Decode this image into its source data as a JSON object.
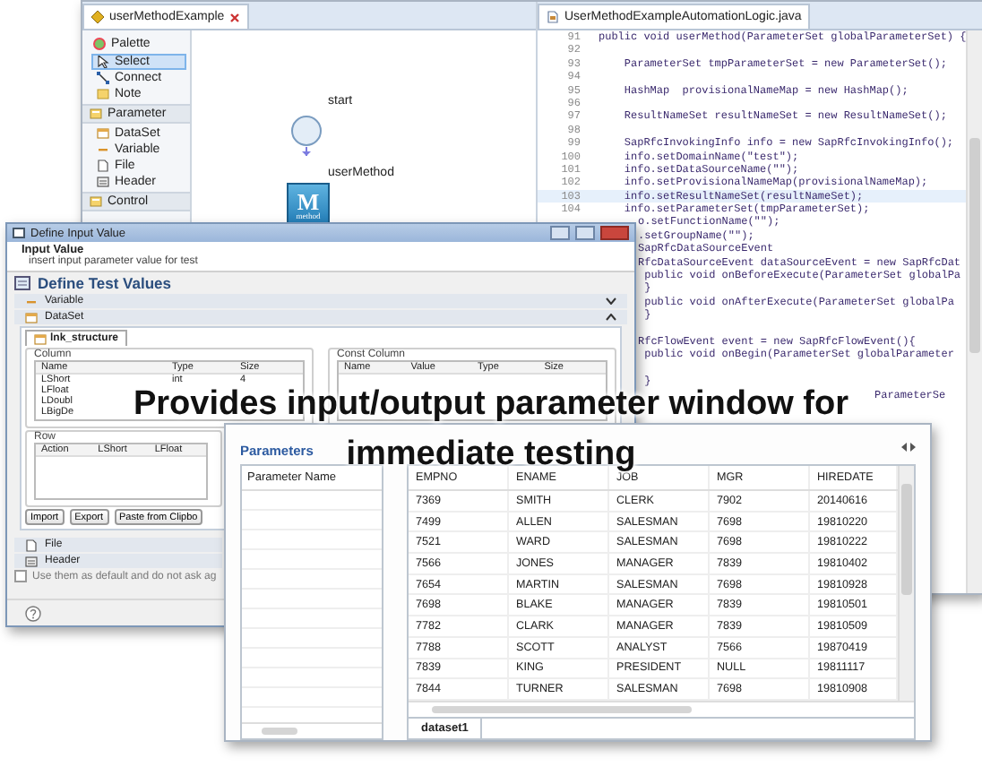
{
  "editor": {
    "diagram_tab": "userMethodExample",
    "code_tab": "UserMethodExampleAutomationLogic.java",
    "palette": {
      "title": "Palette",
      "items": [
        {
          "kind": "select",
          "label": "Select",
          "selected": true
        },
        {
          "kind": "connect",
          "label": "Connect",
          "selected": false
        },
        {
          "kind": "note",
          "label": "Note",
          "selected": false
        },
        {
          "kind": "drawer",
          "label": "Parameter"
        },
        {
          "kind": "dataset",
          "label": "DataSet"
        },
        {
          "kind": "variable",
          "label": "Variable"
        },
        {
          "kind": "file",
          "label": "File"
        },
        {
          "kind": "header",
          "label": "Header"
        },
        {
          "kind": "drawer",
          "label": "Control"
        }
      ]
    },
    "diagram": {
      "start_label": "start",
      "method_label": "userMethod",
      "method_icon_letter": "M",
      "method_icon_caption": "method"
    },
    "code": {
      "lines": [
        {
          "kind": "numbered",
          "number": "91",
          "text": "public void userMethod(ParameterSet globalParameterSet) {",
          "highlighted": false
        },
        {
          "kind": "numbered",
          "number": "92",
          "highlighted": false
        },
        {
          "kind": "numbered",
          "number": "93",
          "text": "    ParameterSet tmpParameterSet = new ParameterSet();",
          "highlighted": false
        },
        {
          "kind": "numbered",
          "number": "94",
          "highlighted": false
        },
        {
          "kind": "numbered",
          "number": "95",
          "text": "    HashMap  provisionalNameMap = new HashMap();",
          "highlighted": false
        },
        {
          "kind": "numbered",
          "number": "96",
          "highlighted": false
        },
        {
          "kind": "numbered",
          "number": "97",
          "text": "    ResultNameSet resultNameSet = new ResultNameSet();",
          "highlighted": false
        },
        {
          "kind": "numbered",
          "number": "98",
          "highlighted": false
        },
        {
          "kind": "numbered",
          "number": "99",
          "text": "    SapRfcInvokingInfo info = new SapRfcInvokingInfo();",
          "highlighted": false
        },
        {
          "kind": "numbered",
          "number": "100",
          "text": "    info.setDomainName(\"test\");",
          "highlighted": false
        },
        {
          "kind": "numbered",
          "number": "101",
          "text": "    info.setDataSourceName(\"\");",
          "highlighted": false
        },
        {
          "kind": "numbered",
          "number": "102",
          "text": "    info.setProvisionalNameMap(provisionalNameMap);",
          "highlighted": false
        },
        {
          "kind": "numbered",
          "number": "103",
          "text": "    info.setResultNameSet(resultNameSet);",
          "highlighted": true
        },
        {
          "kind": "numbered",
          "number": "104",
          "text": "    info.setParameterSet(tmpParameterSet);",
          "highlighted": false
        },
        {
          "kind": "covered",
          "text": "o.setFunctionName(\"\");",
          "highlighted": false
        },
        {
          "kind": "covered",
          "text": ".setGroupName(\"\");",
          "highlighted": false
        },
        {
          "kind": "covered",
          "text": "SapRfcDataSourceEvent",
          "highlighted": false
        },
        {
          "kind": "covered",
          "text": "RfcDataSourceEvent dataSourceEvent = new SapRfcDat",
          "highlighted": false
        },
        {
          "kind": "covered",
          "text": " public void onBeforeExecute(ParameterSet globalPa",
          "highlighted": false
        },
        {
          "kind": "covered",
          "text": " }",
          "highlighted": false
        },
        {
          "kind": "covered",
          "text": " public void onAfterExecute(ParameterSet globalPa",
          "highlighted": false
        },
        {
          "kind": "covered",
          "text": " }",
          "highlighted": false
        },
        {
          "kind": "covered",
          "highlighted": false
        },
        {
          "kind": "covered",
          "text": "RfcFlowEvent event = new SapRfcFlowEvent(){",
          "highlighted": false
        },
        {
          "kind": "covered",
          "text": " public void onBegin(ParameterSet globalParameter",
          "highlighted": false
        },
        {
          "kind": "covered",
          "highlighted": false
        },
        {
          "kind": "covered",
          "text": " }",
          "highlighted": false
        },
        {
          "kind": "right",
          "text": "ParameterSe",
          "highlighted": false
        }
      ]
    }
  },
  "dialog": {
    "title": "Define Input Value",
    "header_title": "Input Value",
    "header_text": "insert input parameter value for test",
    "section_title": "Define Test Values",
    "sections": [
      {
        "label": "Variable",
        "expanded": false
      },
      {
        "label": "DataSet",
        "expanded": true
      }
    ],
    "tabs": [
      {
        "label": "lnk_structure",
        "selected": true
      }
    ],
    "column_group": {
      "title": "Column",
      "columns": [
        "Name",
        "Type",
        "Size"
      ],
      "rows": [
        [
          "LShort",
          "int",
          "4"
        ],
        [
          "LFloat",
          "",
          ""
        ],
        [
          "LDoubl",
          "",
          ""
        ],
        [
          "LBigDe",
          "",
          ""
        ]
      ]
    },
    "const_group": {
      "title": "Const Column",
      "columns": [
        "Name",
        "Value",
        "Type",
        "Size"
      ]
    },
    "row_group": {
      "title": "Row",
      "columns": [
        "Action",
        "LShort",
        "LFloat"
      ]
    },
    "buttons": [
      "Import",
      "Export",
      "Paste from Clipbo"
    ],
    "bottom_sections": [
      {
        "label": "File",
        "kind": "file"
      },
      {
        "label": "Header",
        "kind": "header"
      }
    ],
    "checkbox": {
      "label": "Use them as default and do not ask ag",
      "checked": false
    }
  },
  "parameters_panel": {
    "title": "Parameters",
    "list_header": "Parameter Name",
    "table": {
      "columns": [
        "EMPNO",
        "ENAME",
        "JOB",
        "MGR",
        "HIREDATE"
      ],
      "rows": [
        [
          "7369",
          "SMITH",
          "CLERK",
          "7902",
          "20140616"
        ],
        [
          "7499",
          "ALLEN",
          "SALESMAN",
          "7698",
          "19810220"
        ],
        [
          "7521",
          "WARD",
          "SALESMAN",
          "7698",
          "19810222"
        ],
        [
          "7566",
          "JONES",
          "MANAGER",
          "7839",
          "19810402"
        ],
        [
          "7654",
          "MARTIN",
          "SALESMAN",
          "7698",
          "19810928"
        ],
        [
          "7698",
          "BLAKE",
          "MANAGER",
          "7839",
          "19810501"
        ],
        [
          "7782",
          "CLARK",
          "MANAGER",
          "7839",
          "19810509"
        ],
        [
          "7788",
          "SCOTT",
          "ANALYST",
          "7566",
          "19870419"
        ],
        [
          "7839",
          "KING",
          "PRESIDENT",
          "NULL",
          "19811117"
        ],
        [
          "7844",
          "TURNER",
          "SALESMAN",
          "7698",
          "19810908"
        ]
      ]
    },
    "tabs": [
      {
        "label": "dataset1",
        "selected": true
      }
    ]
  },
  "caption": [
    "Provides input/output parameter window for",
    "immediate testing"
  ]
}
